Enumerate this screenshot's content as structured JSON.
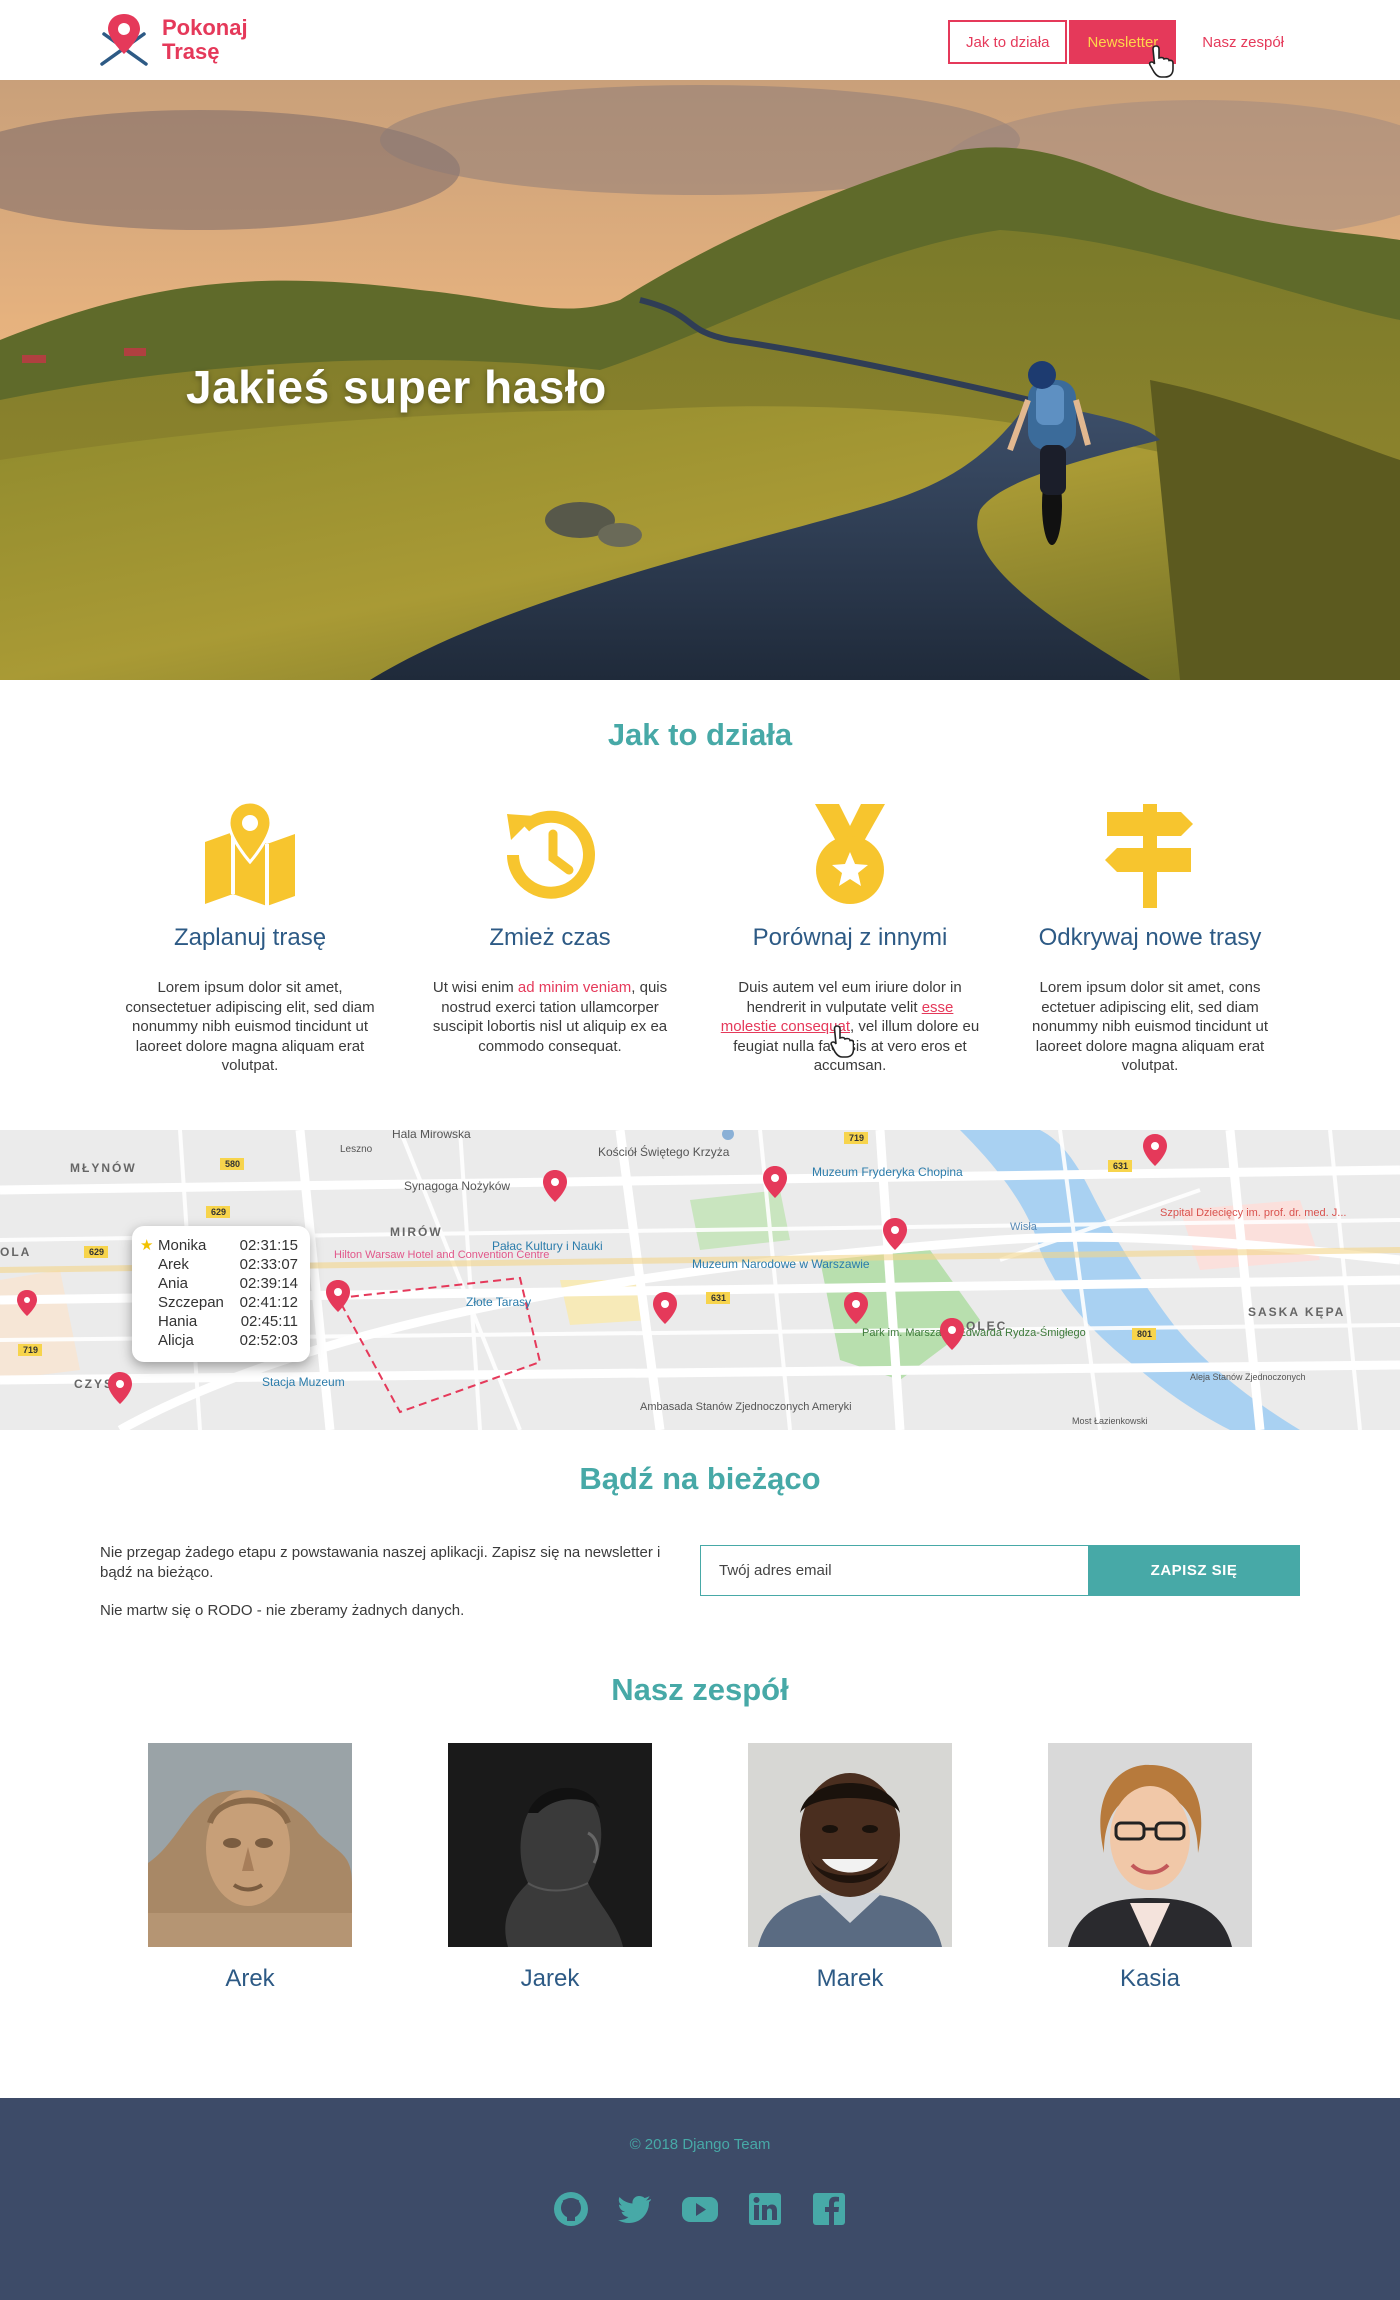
{
  "header": {
    "logo_line1": "Pokonaj",
    "logo_line2": "Trasę",
    "nav": [
      {
        "label": "Jak to działa"
      },
      {
        "label": "Newsletter"
      },
      {
        "label": "Nasz zespół"
      }
    ]
  },
  "hero": {
    "title": "Jakieś super hasło"
  },
  "how_it_works": {
    "title": "Jak to działa",
    "features": [
      {
        "icon": "map-icon",
        "title": "Zaplanuj trasę",
        "text": "Lorem ipsum dolor sit amet, consectetuer adipiscing elit, sed diam nonummy nibh euismod tincidunt ut laoreet dolore magna aliquam erat volutpat."
      },
      {
        "icon": "history-clock-icon",
        "title": "Zmież czas",
        "text_pre": "Ut wisi enim ",
        "text_link": "ad minim veniam",
        "text_post": ", quis nostrud exerci tation ullamcorper suscipit lobortis nisl ut aliquip ex ea commodo consequat."
      },
      {
        "icon": "medal-icon",
        "title": "Porównaj z innymi",
        "text_pre": "Duis autem vel eum iriure dolor in hendrerit in vulputate velit ",
        "text_link": "esse molestie consequat",
        "text_post": ", vel illum dolore eu feugiat nulla facilisis at vero eros et accumsan."
      },
      {
        "icon": "signpost-icon",
        "title": "Odkrywaj nowe trasy",
        "text": "Lorem ipsum dolor sit amet, cons ectetuer adipiscing elit, sed diam nonummy nibh euismod tincidunt ut laoreet dolore magna aliquam erat volutpat."
      }
    ]
  },
  "map": {
    "labels": {
      "hala": "Hala Mirowska",
      "mlynow": "MŁYNÓW",
      "leszno": "Leszno",
      "synagoga": "Synagoga Nożyków",
      "kosciol": "Kościół Świętego Krzyża",
      "muzeum_chopin": "Muzeum Fryderyka Chopina",
      "mirow": "MIRÓW",
      "palac": "Pałac Kultury i Nauki",
      "hilton": "Hilton Warsaw Hotel and Convention Centre",
      "zlote": "Złote Tarasy",
      "muzeum_narodowe": "Muzeum Narodowe w Warszawie",
      "szpital": "Szpital Dziecięcy im. prof. dr. med. J...",
      "saska": "SASKA KĘPA",
      "park": "Park im. Marszałka Edwarda Rydza-Śmigłego",
      "stacja": "Stacja Muzeum",
      "ambasada": "Ambasada Stanów Zjednoczonych Ameryki",
      "czyste": "CZYSTE",
      "ola": "OLA",
      "wisla": "Wisła",
      "solec": "OLEC",
      "most": "Most Łazienkowski",
      "aleja": "Aleja Stanów Zjednoczonych",
      "road_719": "719",
      "road_580": "580",
      "road_629": "629",
      "road_631": "631",
      "road_801": "801"
    },
    "leaderboard": [
      {
        "name": "Monika",
        "time": "02:31:15",
        "starred": true
      },
      {
        "name": "Arek",
        "time": "02:33:07",
        "starred": false
      },
      {
        "name": "Ania",
        "time": "02:39:14",
        "starred": false
      },
      {
        "name": "Szczepan",
        "time": "02:41:12",
        "starred": false
      },
      {
        "name": "Hania",
        "time": "02:45:11",
        "starred": false
      },
      {
        "name": "Alicja",
        "time": "02:52:03",
        "starred": false
      }
    ]
  },
  "newsletter": {
    "title": "Bądź na bieżąco",
    "text1": "Nie przegap żadego etapu z powstawania naszej aplikacji. Zapisz się na newsletter i bądź na bieżąco.",
    "text2": "Nie martw się o RODO - nie zberamy żadnych danych.",
    "placeholder": "Twój adres email",
    "button": "ZAPISZ SIĘ"
  },
  "team": {
    "title": "Nasz zespół",
    "members": [
      {
        "name": "Arek"
      },
      {
        "name": "Jarek"
      },
      {
        "name": "Marek"
      },
      {
        "name": "Kasia"
      }
    ]
  },
  "footer": {
    "copyright": "© 2018 Django Team",
    "socials": [
      "github-icon",
      "twitter-icon",
      "youtube-icon",
      "linkedin-icon",
      "facebook-icon"
    ]
  },
  "colors": {
    "brand_red": "#e5395a",
    "teal": "#47a9a7",
    "navy_text": "#2d5a85",
    "yellow": "#f7c52e",
    "footer_bg": "#3d4b68"
  }
}
